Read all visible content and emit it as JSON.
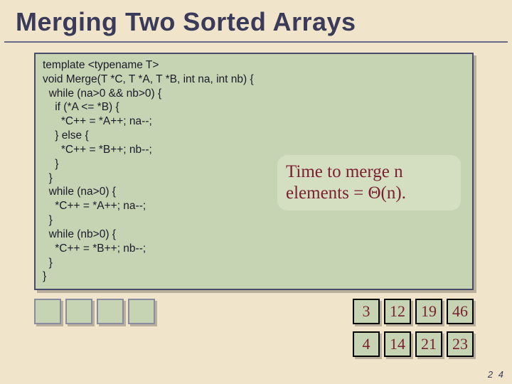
{
  "title": "Merging Two Sorted Arrays",
  "code": "template <typename T>\nvoid Merge(T *C, T *A, T *B, int na, int nb) {\n  while (na>0 && nb>0) {\n    if (*A <= *B) {\n      *C++ = *A++; na--;\n    } else {\n      *C++ = *B++; nb--;\n    }\n  }\n  while (na>0) {\n    *C++ = *A++; na--;\n  }\n  while (nb>0) {\n    *C++ = *B++; nb--;\n  }\n}",
  "callout": {
    "line1_prefix": "Time to merge ",
    "line1_hl": "n",
    "line2_prefix": "elements = ",
    "line2_hl": "Θ(n)",
    "line2_suffix": "."
  },
  "empty_cells": [
    "",
    "",
    "",
    ""
  ],
  "row_a": [
    "3",
    "12",
    "19",
    "46"
  ],
  "row_b": [
    "4",
    "14",
    "21",
    "23"
  ],
  "page_number": "2 4"
}
